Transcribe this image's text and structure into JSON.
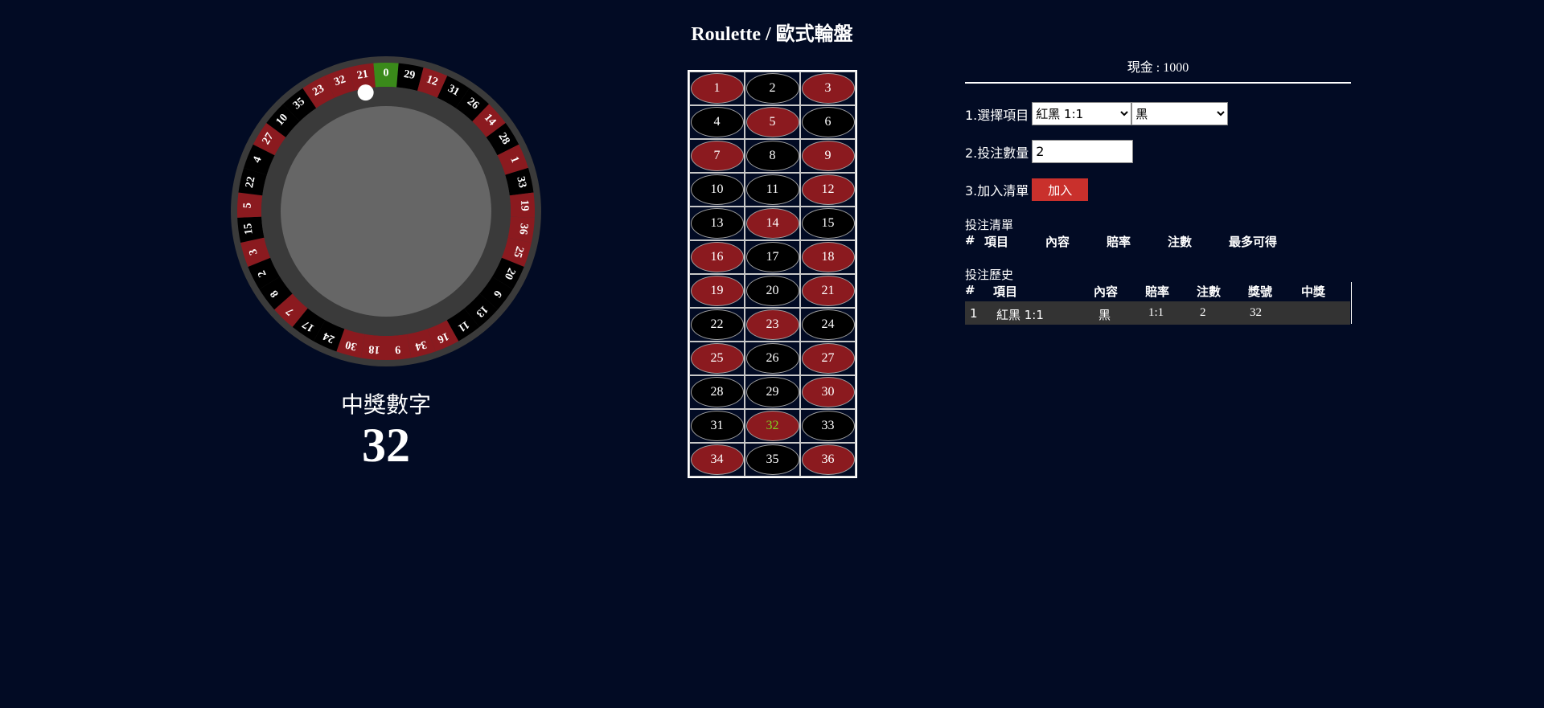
{
  "title": "Roulette / 歐式輪盤",
  "wheel": {
    "numbers": [
      0,
      29,
      12,
      31,
      26,
      14,
      28,
      1,
      33,
      19,
      36,
      25,
      20,
      6,
      13,
      11,
      16,
      34,
      9,
      18,
      30,
      24,
      17,
      7,
      8,
      2,
      3,
      15,
      5,
      22,
      4,
      27,
      10,
      35,
      23,
      32,
      21
    ],
    "red_numbers": [
      1,
      3,
      5,
      7,
      9,
      12,
      14,
      16,
      18,
      19,
      21,
      23,
      25,
      27,
      30,
      32,
      34,
      36
    ],
    "colors": {
      "red": "#8b1a1f",
      "black": "#000000",
      "green": "#3a8a1a",
      "rim": "#3a3a3a",
      "center": "#666666",
      "ball": "#ffffff"
    },
    "ball_number": 21
  },
  "prize": {
    "label": "中獎數字",
    "number": "32"
  },
  "board": {
    "numbers": [
      1,
      2,
      3,
      4,
      5,
      6,
      7,
      8,
      9,
      10,
      11,
      12,
      13,
      14,
      15,
      16,
      17,
      18,
      19,
      20,
      21,
      22,
      23,
      24,
      25,
      26,
      27,
      28,
      29,
      30,
      31,
      32,
      33,
      34,
      35,
      36
    ],
    "winning": 32
  },
  "panel": {
    "cash_label": "現金 : 1000",
    "step1_label": "1.選擇項目",
    "step1_select1": "紅黑 1:1",
    "step1_select2": "黑",
    "step2_label": "2.投注數量",
    "step2_value": "2",
    "step3_label": "3.加入清單",
    "add_button": "加入",
    "bet_list_title": "投注清單",
    "bet_list_headers": [
      "#",
      "項目",
      "內容",
      "賠率",
      "注數",
      "最多可得"
    ],
    "history_title": "投注歷史",
    "history_headers": [
      "#",
      "項目",
      "內容",
      "賠率",
      "注數",
      "獎號",
      "中獎"
    ],
    "history_rows": [
      {
        "no": "1",
        "item": "紅黑 1:1",
        "content": "黑",
        "odds": "1:1",
        "bets": "2",
        "prize_no": "32",
        "win": ""
      }
    ]
  }
}
